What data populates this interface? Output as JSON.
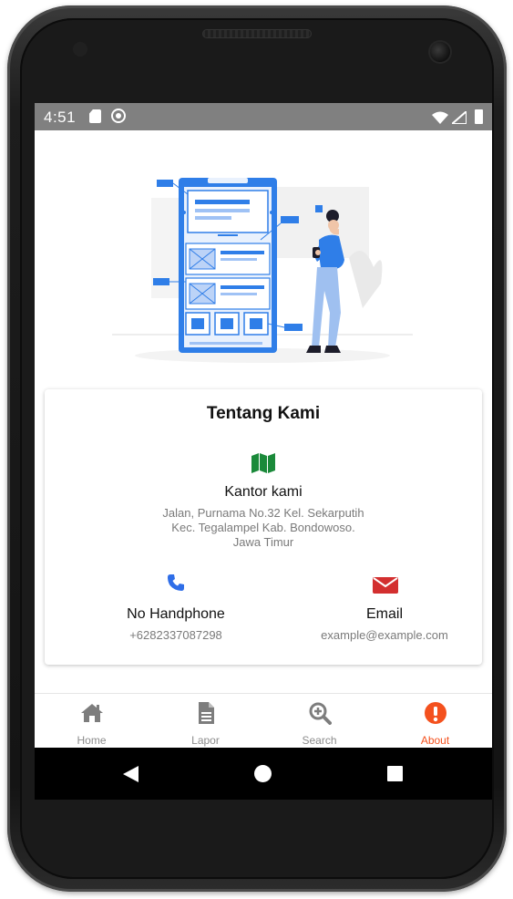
{
  "status_bar": {
    "time": "4:51"
  },
  "about_card": {
    "title": "Tentang Kami",
    "office": {
      "title": "Kantor kami",
      "address_line1": "Jalan, Purnama No.32 Kel. Sekarputih",
      "address_line2": "Kec. Tegalampel Kab. Bondowoso.",
      "address_line3": "Jawa Timur",
      "icon": "map-icon",
      "icon_color": "#1b8a3a"
    },
    "phone": {
      "title": "No Handphone",
      "value": "+6282337087298",
      "icon": "phone-icon",
      "icon_color": "#2f6ee8"
    },
    "email": {
      "title": "Email",
      "value": "example@example.com",
      "icon": "mail-icon",
      "icon_color": "#d32f2f"
    }
  },
  "bottom_nav": {
    "items": [
      {
        "label": "Home",
        "icon": "home-icon"
      },
      {
        "label": "Lapor",
        "icon": "document-icon"
      },
      {
        "label": "Search",
        "icon": "zoom-in-icon"
      },
      {
        "label": "About",
        "icon": "exclamation-circle-icon",
        "active": true
      }
    ],
    "active_color": "#f4511e",
    "inactive_color": "#7d7d7d"
  },
  "colors": {
    "status_bar": "#808080",
    "illustration_primary": "#2f7ee8",
    "android_nav": "#000000"
  }
}
